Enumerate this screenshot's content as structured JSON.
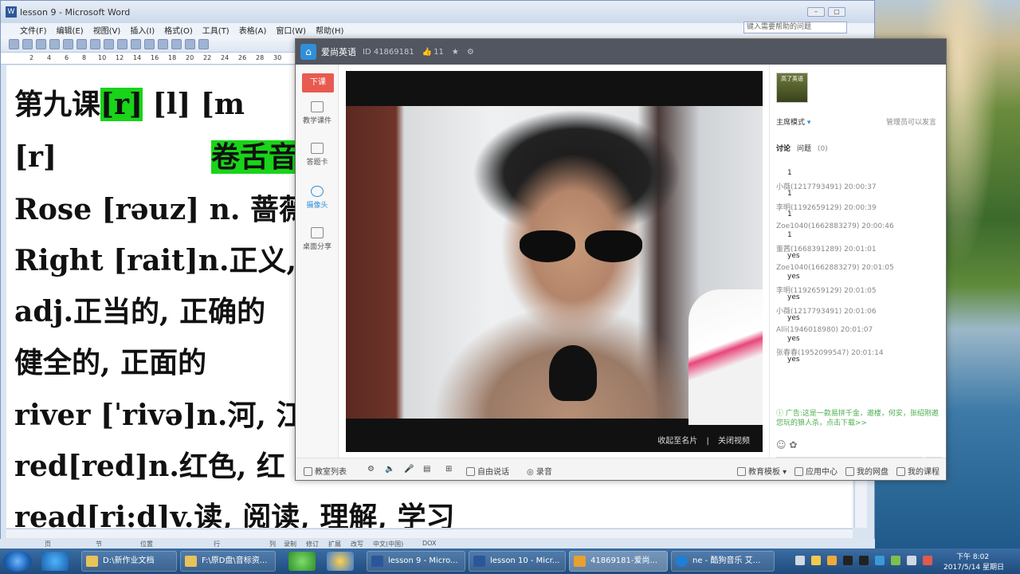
{
  "word": {
    "title": "lesson 9 - Microsoft Word",
    "menu": [
      "文件(F)",
      "编辑(E)",
      "视图(V)",
      "插入(I)",
      "格式(O)",
      "工具(T)",
      "表格(A)",
      "窗口(W)",
      "帮助(H)"
    ],
    "help_placeholder": "键入需要帮助的问题",
    "ruler": [
      "2",
      "4",
      "6",
      "8",
      "10",
      "12",
      "14",
      "16",
      "18",
      "20",
      "22",
      "24",
      "26",
      "28",
      "30"
    ],
    "doc_lines": [
      {
        "pre": "第九课",
        "hl": "[r]",
        "post": "    [l]    [m"
      },
      {
        "pre": "[r]           ",
        "hl": "卷舌音",
        "post": ""
      },
      {
        "pre": "Rose [rəuz] n.  蔷薇",
        "hl": "",
        "post": ""
      },
      {
        "pre": "Right [rait]n.正义,",
        "hl": "",
        "post": ""
      },
      {
        "pre": "adj.正当的, 正确的",
        "hl": "",
        "post": ""
      },
      {
        "pre": "健全的, 正面的",
        "hl": "",
        "post": ""
      },
      {
        "pre": "river [ˈrivə]n.河, 江",
        "hl": "",
        "post": ""
      },
      {
        "pre": "red[red]n.红色, 红",
        "hl": "",
        "post": ""
      },
      {
        "pre": "read[ri:d]v.读, 阅读, 理解, 学习",
        "hl": "",
        "post": ""
      }
    ],
    "status": [
      "页",
      "节",
      "位置",
      "行",
      "列",
      "录制",
      "修订",
      "扩展",
      "改写",
      "中文(中国)",
      "DOX"
    ]
  },
  "app": {
    "name": "爱尚英语",
    "id_label": "ID 41869181",
    "likes": "11",
    "end_class": "下课",
    "side": [
      {
        "label": "教学课件",
        "icon": "courseware-icon"
      },
      {
        "label": "答题卡",
        "icon": "answer-card-icon"
      },
      {
        "label": "摄像头",
        "icon": "camera-icon"
      },
      {
        "label": "桌面分享",
        "icon": "desktop-share-icon"
      }
    ],
    "video_links": [
      "收起至名片",
      "|",
      "关闭视频"
    ],
    "bottom": {
      "classroom_list": "教室列表",
      "free_talk": "自由说话",
      "record": "录音",
      "edu_template": "教育模板",
      "app_center": "应用中心",
      "netdisk": "我的网盘",
      "my_courses": "我的课程"
    },
    "right": {
      "avatar_text": "高了英语",
      "mode": "主席模式",
      "admin_note": "管理员可以发言",
      "tabs": {
        "discuss": "讨论",
        "questions": "问题",
        "q_count": "(0)"
      },
      "chat": [
        {
          "name": "",
          "body": "1"
        },
        {
          "name": "小薇(1217793491) 20:00:37",
          "body": "1"
        },
        {
          "name": "李明(1192659129) 20:00:39",
          "body": "1"
        },
        {
          "name": "Zoe1040(1662883279) 20:00:46",
          "body": "1"
        },
        {
          "name": "董茜(1668391289) 20:01:01",
          "body": "yes"
        },
        {
          "name": "Zoe1040(1662883279) 20:01:05",
          "body": "yes"
        },
        {
          "name": "李明(1192659129) 20:01:05",
          "body": "yes"
        },
        {
          "name": "小薇(1217793491) 20:01:06",
          "body": "yes"
        },
        {
          "name": "Alli(1946018980) 20:01:07",
          "body": "yes"
        },
        {
          "name": "张春春(1952099547) 20:01:14",
          "body": "yes"
        }
      ],
      "ad": "广告:这是一款易拼千金，邀楼，何安，张绍刚邀您玩的狼人杀，点击下载>>",
      "send": "➤"
    }
  },
  "taskbar": {
    "tasks": [
      "D:\\新作业文档",
      "F:\\原D盘\\音标资...",
      "lesson 9 - Micro...",
      "lesson 10 - Micr...",
      "41869181-爱尚...",
      "ne - 酷狗音乐 艾..."
    ],
    "time": "下午 8:02",
    "date": "2017/5/14 星期日"
  }
}
